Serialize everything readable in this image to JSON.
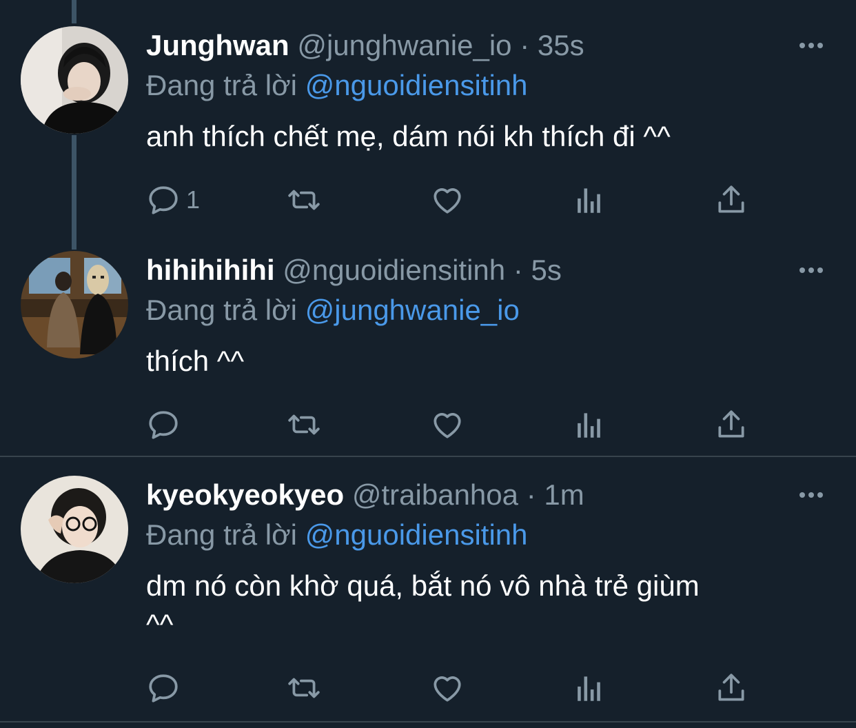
{
  "tweets": [
    {
      "name": "Junghwan",
      "handle": "@junghwanie_io",
      "dot": "·",
      "time": "35s",
      "replying_prefix": "Đang trả lời",
      "replying_to": "@nguoidiensitinh",
      "text_lines": [
        "anh thích chết mẹ, dám nói kh thích đi ^^"
      ],
      "reply_count": "1"
    },
    {
      "name": "hihihihihi",
      "handle": "@nguoidiensitinh",
      "dot": "·",
      "time": "5s",
      "replying_prefix": "Đang trả lời",
      "replying_to": "@junghwanie_io",
      "text_lines": [
        "thích ^^"
      ],
      "reply_count": ""
    },
    {
      "name": "kyeokyeokyeo",
      "handle": "@traibanhoa",
      "dot": "·",
      "time": "1m",
      "replying_prefix": "Đang trả lời",
      "replying_to": "@nguoidiensitinh",
      "text_lines": [
        "dm nó còn khờ quá, bắt nó vô nhà trẻ giùm",
        "^^"
      ],
      "reply_count": ""
    }
  ],
  "icons": {
    "reply": "reply-icon",
    "retweet": "retweet-icon",
    "like": "heart-icon",
    "analytics": "analytics-icon",
    "share": "share-icon",
    "more": "more-icon"
  },
  "colors": {
    "background": "#15202b",
    "secondary_text": "#8899a6",
    "mention": "#4a99e9",
    "divider": "#38444d"
  }
}
